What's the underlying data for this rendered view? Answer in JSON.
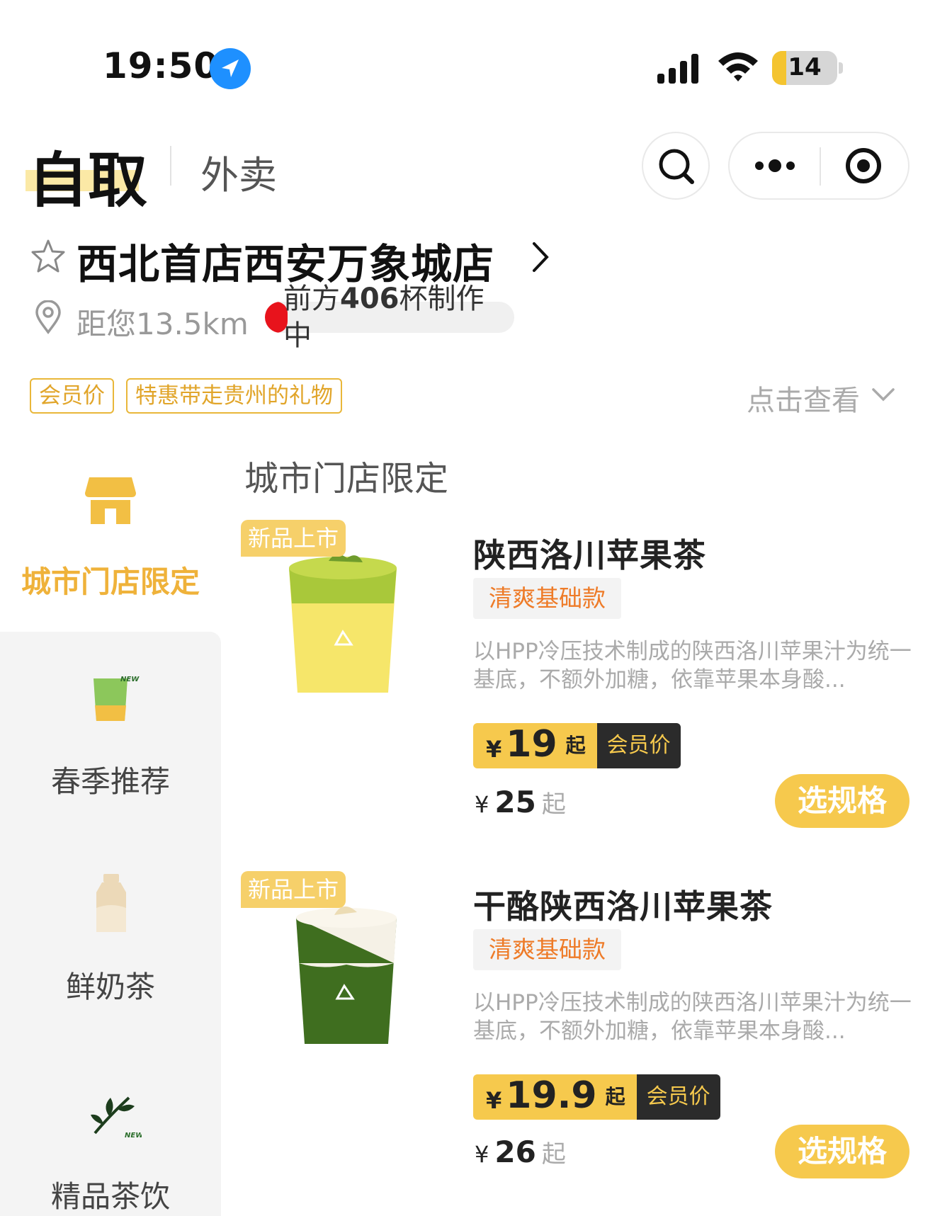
{
  "status_bar": {
    "time": "19:50",
    "battery": "14",
    "battery_level": 0.22
  },
  "header": {
    "tab_active": "自取",
    "tab_inactive": "外卖"
  },
  "store": {
    "name": "西北首店西安万象城店",
    "distance": "距您13.5km",
    "queue_prefix": "前方",
    "queue_count": "406",
    "queue_suffix": "杯制作中",
    "queue_progress": 0.09
  },
  "promo": {
    "tags": [
      "会员价",
      "特惠带走贵州的礼物"
    ],
    "view_more": "点击查看"
  },
  "sidebar": {
    "items": [
      {
        "label": "城市门店限定",
        "active": true
      },
      {
        "label": "春季推荐",
        "active": false
      },
      {
        "label": "鲜奶茶",
        "active": false
      },
      {
        "label": "精品茶饮",
        "active": false
      }
    ]
  },
  "section": {
    "title": "城市门店限定"
  },
  "products": [
    {
      "badge": "新品上市",
      "name": "陕西洛川苹果茶",
      "tag": "清爽基础款",
      "desc": "以HPP冷压技术制成的陕西洛川苹果汁为统一基底，不额外加糖，依靠苹果本身酸...",
      "currency": "¥",
      "member_price": "19",
      "price_from": "起",
      "member_label": "会员价",
      "orig_price": "25",
      "button": "选规格"
    },
    {
      "badge": "新品上市",
      "name": "干酪陕西洛川苹果茶",
      "tag": "清爽基础款",
      "desc": "以HPP冷压技术制成的陕西洛川苹果汁为统一基底，不额外加糖，依靠苹果本身酸...",
      "currency": "¥",
      "member_price": "19.9",
      "price_from": "起",
      "member_label": "会员价",
      "orig_price": "26",
      "button": "选规格"
    }
  ],
  "colors": {
    "accent": "#F6C94D",
    "accent_text": "#EFB23A",
    "progress": "#E8131C",
    "tag_orange": "#EE7B28",
    "location_blue": "#1E90FF"
  }
}
